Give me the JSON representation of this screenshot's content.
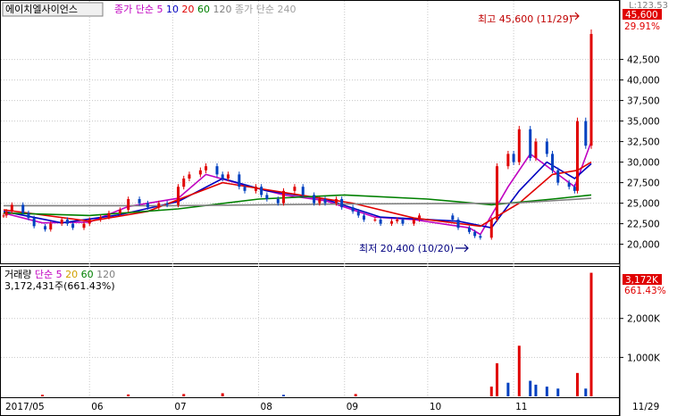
{
  "header": {
    "stock_name": "에이치엘사이언스",
    "price_ma_label": "종가 단순",
    "price_ma_periods": [
      {
        "label": "5",
        "color": "#c000c0"
      },
      {
        "label": "10",
        "color": "#0000c0"
      },
      {
        "label": "20",
        "color": "#e00000"
      },
      {
        "label": "60",
        "color": "#008000"
      },
      {
        "label": "120",
        "color": "#808080"
      }
    ],
    "price_ma_extra": "종가 단순 240"
  },
  "volume_header": {
    "title": "거래량",
    "ma_label": "단순",
    "periods": [
      {
        "label": "5",
        "color": "#c000c0"
      },
      {
        "label": "20",
        "color": "#d0a000"
      },
      {
        "label": "60",
        "color": "#008000"
      },
      {
        "label": "120",
        "color": "#808080"
      }
    ],
    "current_volume_text": "3,172,431주(661.43%)"
  },
  "right_axis_labels": {
    "price_top_partial": "L:123.53",
    "current_price_badge": "45,600",
    "current_change_pct": "29.91%",
    "volume_badge": "3,172K",
    "volume_change_pct": "661.43%"
  },
  "annotations": {
    "high": "최고 45,600 (11/29)",
    "low": "최저 20,400 (10/20)"
  },
  "colors": {
    "up": "#e00000",
    "down": "#0040c0",
    "ma5": "#c000c0",
    "ma10": "#0000c0",
    "ma20": "#e00000",
    "ma60": "#008000",
    "ma120": "#808080",
    "ma240": "#a0a0a0",
    "badge": "#e00000"
  },
  "chart_data": {
    "type": "candlestick",
    "date_axis": {
      "labels": [
        {
          "text": "2017/05",
          "date": "2017-05-01"
        },
        {
          "text": "06",
          "date": "2017-06-01"
        },
        {
          "text": "07",
          "date": "2017-07-01"
        },
        {
          "text": "08",
          "date": "2017-08-01"
        },
        {
          "text": "09",
          "date": "2017-09-01"
        },
        {
          "text": "10",
          "date": "2017-10-01"
        },
        {
          "text": "11",
          "date": "2017-11-01"
        },
        {
          "text": "11/29",
          "date": "2017-11-29"
        }
      ]
    },
    "price_axis": {
      "ylim": [
        18000,
        48000
      ],
      "ticks": [
        20000,
        22500,
        25000,
        27500,
        30000,
        32500,
        35000,
        37500,
        40000,
        42500
      ],
      "tick_labels": [
        "20,000",
        "22,500",
        "25,000",
        "27,500",
        "30,000",
        "32,500",
        "35,000",
        "37,500",
        "40,000",
        "42,500"
      ]
    },
    "volume_axis": {
      "ylim": [
        0,
        3300000
      ],
      "ticks": [
        1000000,
        2000000
      ],
      "tick_labels": [
        "1,000K",
        "2,000K"
      ]
    },
    "price_series": [
      {
        "date": "2017-05-01",
        "close": 23500
      },
      {
        "date": "2017-05-02",
        "close": 24000
      },
      {
        "date": "2017-05-04",
        "close": 24800
      },
      {
        "date": "2017-05-08",
        "close": 23800
      },
      {
        "date": "2017-05-10",
        "close": 23200
      },
      {
        "date": "2017-05-12",
        "close": 22200
      },
      {
        "date": "2017-05-16",
        "close": 21800
      },
      {
        "date": "2017-05-18",
        "close": 22500
      },
      {
        "date": "2017-05-22",
        "close": 23000
      },
      {
        "date": "2017-05-24",
        "close": 22500
      },
      {
        "date": "2017-05-26",
        "close": 22000
      },
      {
        "date": "2017-05-30",
        "close": 22500
      },
      {
        "date": "2017-06-01",
        "close": 23000
      },
      {
        "date": "2017-06-05",
        "close": 23300
      },
      {
        "date": "2017-06-08",
        "close": 23800
      },
      {
        "date": "2017-06-12",
        "close": 24200
      },
      {
        "date": "2017-06-15",
        "close": 25500
      },
      {
        "date": "2017-06-19",
        "close": 25000
      },
      {
        "date": "2017-06-22",
        "close": 24500
      },
      {
        "date": "2017-06-26",
        "close": 25000
      },
      {
        "date": "2017-06-29",
        "close": 24800
      },
      {
        "date": "2017-07-03",
        "close": 27000
      },
      {
        "date": "2017-07-05",
        "close": 28000
      },
      {
        "date": "2017-07-07",
        "close": 28500
      },
      {
        "date": "2017-07-11",
        "close": 29000
      },
      {
        "date": "2017-07-13",
        "close": 29500
      },
      {
        "date": "2017-07-17",
        "close": 28500
      },
      {
        "date": "2017-07-19",
        "close": 28000
      },
      {
        "date": "2017-07-21",
        "close": 28500
      },
      {
        "date": "2017-07-25",
        "close": 27000
      },
      {
        "date": "2017-07-27",
        "close": 26500
      },
      {
        "date": "2017-07-31",
        "close": 27000
      },
      {
        "date": "2017-08-02",
        "close": 26000
      },
      {
        "date": "2017-08-04",
        "close": 25500
      },
      {
        "date": "2017-08-08",
        "close": 25000
      },
      {
        "date": "2017-08-10",
        "close": 26500
      },
      {
        "date": "2017-08-14",
        "close": 27000
      },
      {
        "date": "2017-08-17",
        "close": 26000
      },
      {
        "date": "2017-08-21",
        "close": 25000
      },
      {
        "date": "2017-08-23",
        "close": 25500
      },
      {
        "date": "2017-08-25",
        "close": 25000
      },
      {
        "date": "2017-08-29",
        "close": 25500
      },
      {
        "date": "2017-08-31",
        "close": 24500
      },
      {
        "date": "2017-09-04",
        "close": 24000
      },
      {
        "date": "2017-09-06",
        "close": 23500
      },
      {
        "date": "2017-09-08",
        "close": 23000
      },
      {
        "date": "2017-09-12",
        "close": 23000
      },
      {
        "date": "2017-09-14",
        "close": 22500
      },
      {
        "date": "2017-09-18",
        "close": 22800
      },
      {
        "date": "2017-09-20",
        "close": 23000
      },
      {
        "date": "2017-09-22",
        "close": 22500
      },
      {
        "date": "2017-09-26",
        "close": 23000
      },
      {
        "date": "2017-09-28",
        "close": 23500
      },
      {
        "date": "2017-10-10",
        "close": 23000
      },
      {
        "date": "2017-10-12",
        "close": 22000
      },
      {
        "date": "2017-10-16",
        "close": 21500
      },
      {
        "date": "2017-10-18",
        "close": 21000
      },
      {
        "date": "2017-10-20",
        "close": 20800
      },
      {
        "date": "2017-10-24",
        "close": 23000
      },
      {
        "date": "2017-10-26",
        "close": 29500
      },
      {
        "date": "2017-10-30",
        "close": 31000
      },
      {
        "date": "2017-11-01",
        "close": 30000
      },
      {
        "date": "2017-11-03",
        "close": 34000
      },
      {
        "date": "2017-11-07",
        "close": 30500
      },
      {
        "date": "2017-11-09",
        "close": 32500
      },
      {
        "date": "2017-11-13",
        "close": 31000
      },
      {
        "date": "2017-11-15",
        "close": 29000
      },
      {
        "date": "2017-11-17",
        "close": 27500
      },
      {
        "date": "2017-11-21",
        "close": 27000
      },
      {
        "date": "2017-11-23",
        "close": 26500
      },
      {
        "date": "2017-11-24",
        "close": 35000
      },
      {
        "date": "2017-11-27",
        "close": 32000
      },
      {
        "date": "2017-11-29",
        "close": 45600
      }
    ],
    "volume_series": [
      {
        "date": "2017-05-15",
        "volume": 40000
      },
      {
        "date": "2017-06-15",
        "volume": 50000
      },
      {
        "date": "2017-07-05",
        "volume": 60000
      },
      {
        "date": "2017-07-19",
        "volume": 80000
      },
      {
        "date": "2017-08-10",
        "volume": 40000
      },
      {
        "date": "2017-09-05",
        "volume": 60000
      },
      {
        "date": "2017-10-24",
        "volume": 250000
      },
      {
        "date": "2017-10-26",
        "volume": 850000
      },
      {
        "date": "2017-10-30",
        "volume": 350000
      },
      {
        "date": "2017-11-03",
        "volume": 1300000
      },
      {
        "date": "2017-11-07",
        "volume": 400000
      },
      {
        "date": "2017-11-09",
        "volume": 300000
      },
      {
        "date": "2017-11-13",
        "volume": 250000
      },
      {
        "date": "2017-11-17",
        "volume": 200000
      },
      {
        "date": "2017-11-24",
        "volume": 600000
      },
      {
        "date": "2017-11-27",
        "volume": 200000
      },
      {
        "date": "2017-11-29",
        "volume": 3172431
      }
    ],
    "moving_averages": [
      {
        "name": "5",
        "color": "#c000c0",
        "points": [
          {
            "date": "2017-05-01",
            "value": 23800
          },
          {
            "date": "2017-05-15",
            "value": 22600
          },
          {
            "date": "2017-06-01",
            "value": 22700
          },
          {
            "date": "2017-06-15",
            "value": 24600
          },
          {
            "date": "2017-07-03",
            "value": 25600
          },
          {
            "date": "2017-07-13",
            "value": 28500
          },
          {
            "date": "2017-07-27",
            "value": 27200
          },
          {
            "date": "2017-08-10",
            "value": 26000
          },
          {
            "date": "2017-08-25",
            "value": 25300
          },
          {
            "date": "2017-09-12",
            "value": 23300
          },
          {
            "date": "2017-09-26",
            "value": 23000
          },
          {
            "date": "2017-10-16",
            "value": 22000
          },
          {
            "date": "2017-10-20",
            "value": 21200
          },
          {
            "date": "2017-10-30",
            "value": 27000
          },
          {
            "date": "2017-11-07",
            "value": 31000
          },
          {
            "date": "2017-11-17",
            "value": 28500
          },
          {
            "date": "2017-11-23",
            "value": 27000
          },
          {
            "date": "2017-11-29",
            "value": 32500
          }
        ]
      },
      {
        "name": "10",
        "color": "#0000c0",
        "points": [
          {
            "date": "2017-05-01",
            "value": 24000
          },
          {
            "date": "2017-05-22",
            "value": 22600
          },
          {
            "date": "2017-06-12",
            "value": 23600
          },
          {
            "date": "2017-07-03",
            "value": 25200
          },
          {
            "date": "2017-07-19",
            "value": 28000
          },
          {
            "date": "2017-08-04",
            "value": 26500
          },
          {
            "date": "2017-08-25",
            "value": 25500
          },
          {
            "date": "2017-09-14",
            "value": 23300
          },
          {
            "date": "2017-10-12",
            "value": 22800
          },
          {
            "date": "2017-10-24",
            "value": 22000
          },
          {
            "date": "2017-11-03",
            "value": 26500
          },
          {
            "date": "2017-11-13",
            "value": 30000
          },
          {
            "date": "2017-11-23",
            "value": 28000
          },
          {
            "date": "2017-11-29",
            "value": 29800
          }
        ]
      },
      {
        "name": "20",
        "color": "#e00000",
        "points": [
          {
            "date": "2017-05-01",
            "value": 24200
          },
          {
            "date": "2017-06-01",
            "value": 22800
          },
          {
            "date": "2017-06-22",
            "value": 24000
          },
          {
            "date": "2017-07-19",
            "value": 27500
          },
          {
            "date": "2017-08-10",
            "value": 26300
          },
          {
            "date": "2017-09-04",
            "value": 25000
          },
          {
            "date": "2017-09-26",
            "value": 23200
          },
          {
            "date": "2017-10-20",
            "value": 22200
          },
          {
            "date": "2017-11-03",
            "value": 25000
          },
          {
            "date": "2017-11-15",
            "value": 28500
          },
          {
            "date": "2017-11-24",
            "value": 29000
          },
          {
            "date": "2017-11-29",
            "value": 30000
          }
        ]
      },
      {
        "name": "60",
        "color": "#008000",
        "points": [
          {
            "date": "2017-05-01",
            "value": 23800
          },
          {
            "date": "2017-06-01",
            "value": 23500
          },
          {
            "date": "2017-07-03",
            "value": 24300
          },
          {
            "date": "2017-08-01",
            "value": 25500
          },
          {
            "date": "2017-09-01",
            "value": 26000
          },
          {
            "date": "2017-10-01",
            "value": 25500
          },
          {
            "date": "2017-10-24",
            "value": 24800
          },
          {
            "date": "2017-11-15",
            "value": 25500
          },
          {
            "date": "2017-11-29",
            "value": 26000
          }
        ]
      },
      {
        "name": "120",
        "color": "#808080",
        "points": [
          {
            "date": "2017-05-01",
            "value": 24700
          },
          {
            "date": "2017-07-01",
            "value": 24700
          },
          {
            "date": "2017-09-01",
            "value": 24900
          },
          {
            "date": "2017-11-01",
            "value": 25000
          },
          {
            "date": "2017-11-29",
            "value": 25600
          }
        ]
      }
    ]
  }
}
